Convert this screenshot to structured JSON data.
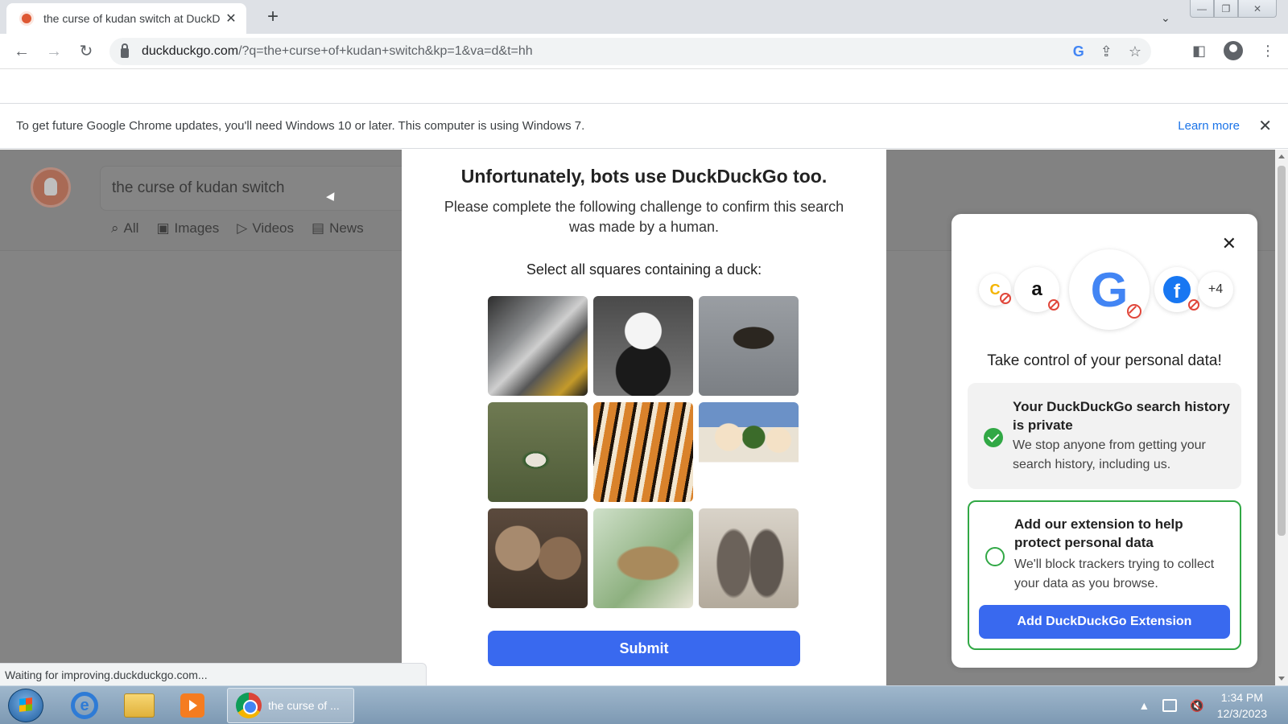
{
  "browser": {
    "tab_title": "the curse of kudan switch at DuckDuckGo",
    "tab_close": "✕",
    "new_tab": "+",
    "tab_search": "⌄",
    "window_controls": [
      "—",
      "❐",
      "✕"
    ],
    "url_host": "duckduckgo.com",
    "url_path": "/?q=the+curse+of+kudan+switch&kp=1&va=d&t=hh",
    "infobar_text": "To get future Google Chrome updates, you'll need Windows 10 or later. This computer is using Windows 7.",
    "infobar_link": "Learn more",
    "infobar_close": "✕",
    "status_text": "Waiting for improving.duckduckgo.com..."
  },
  "ddg": {
    "search_value": "the curse of kudan switch",
    "tabs": [
      {
        "icon": "⌕",
        "label": "All"
      },
      {
        "icon": "▣",
        "label": "Images"
      },
      {
        "icon": "▷",
        "label": "Videos"
      },
      {
        "icon": "▤",
        "label": "News"
      }
    ]
  },
  "challenge": {
    "title": "Unfortunately, bots use DuckDuckGo too.",
    "subtitle": "Please complete the following challenge to confirm this search was made by a human.",
    "instruction": "Select all squares containing a duck:",
    "images": [
      "fish",
      "panda",
      "duck-swimming",
      "mallard-duck",
      "tiger",
      "dogs-on-balcony",
      "bears",
      "duck-illustration",
      "sea-lions"
    ],
    "submit_label": "Submit"
  },
  "promo": {
    "close": "✕",
    "more_count": "+4",
    "title": "Take control of your personal data!",
    "card1_title": "Your DuckDuckGo search history is private",
    "card1_text": "We stop anyone from getting your search history, including us.",
    "card2_title": "Add our extension to help protect personal data",
    "card2_text": "We'll block trackers trying to collect your data as you browse.",
    "button_label": "Add DuckDuckGo Extension"
  },
  "taskbar": {
    "chrome_label": "the curse of ...",
    "time": "1:34 PM",
    "date": "12/3/2023"
  },
  "colors": {
    "accent": "#3969ef",
    "success": "#31a845",
    "link": "#1a73e8"
  }
}
